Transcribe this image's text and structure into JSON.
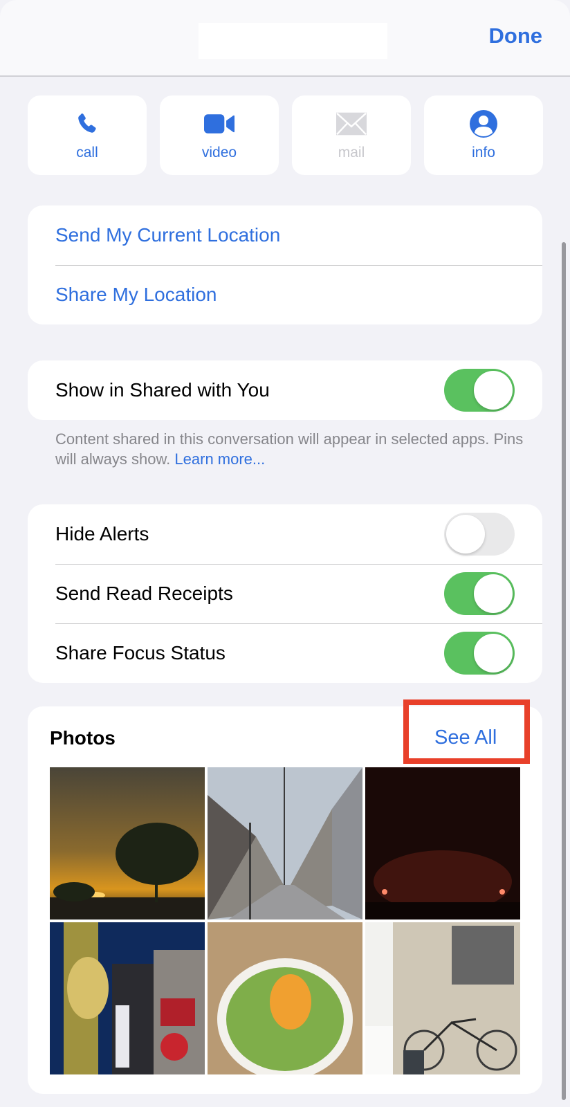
{
  "header": {
    "title": "",
    "done_label": "Done"
  },
  "actions": [
    {
      "label": "call",
      "icon": "phone-icon",
      "enabled": true
    },
    {
      "label": "video",
      "icon": "video-camera-icon",
      "enabled": true
    },
    {
      "label": "mail",
      "icon": "envelope-icon",
      "enabled": false
    },
    {
      "label": "info",
      "icon": "person-circle-icon",
      "enabled": true
    }
  ],
  "location": {
    "send_current": "Send My Current Location",
    "share": "Share My Location"
  },
  "shared_with_you": {
    "label": "Show in Shared with You",
    "on": true,
    "footnote": "Content shared in this conversation will appear in selected apps. Pins will always show.",
    "learn_more": "Learn more..."
  },
  "settings": [
    {
      "label": "Hide Alerts",
      "on": false
    },
    {
      "label": "Send Read Receipts",
      "on": true
    },
    {
      "label": "Share Focus Status",
      "on": true
    }
  ],
  "photos": {
    "title": "Photos",
    "see_all": "See All",
    "items": [
      {
        "description": "Sunset behind a tree"
      },
      {
        "description": "Narrow city street with power lines"
      },
      {
        "description": "Dark concert hall with red stage lights"
      },
      {
        "description": "Night street with neon signs and billboards"
      },
      {
        "description": "Rice bowl topped with green onions and egg yolk"
      },
      {
        "description": "Bicycle in a cafe interior"
      }
    ]
  },
  "colors": {
    "accent": "#2f6fde",
    "toggle_on": "#5ac15f",
    "toggle_off": "#e9e9ea",
    "background": "#f2f2f7",
    "highlight": "#e8402a"
  }
}
